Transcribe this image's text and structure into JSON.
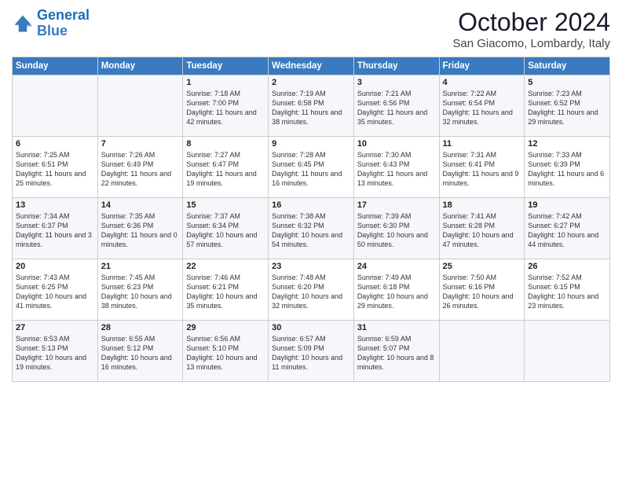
{
  "header": {
    "logo_line1": "General",
    "logo_line2": "Blue",
    "month": "October 2024",
    "location": "San Giacomo, Lombardy, Italy"
  },
  "days_of_week": [
    "Sunday",
    "Monday",
    "Tuesday",
    "Wednesday",
    "Thursday",
    "Friday",
    "Saturday"
  ],
  "weeks": [
    [
      {
        "day": "",
        "content": ""
      },
      {
        "day": "",
        "content": ""
      },
      {
        "day": "1",
        "content": "Sunrise: 7:18 AM\nSunset: 7:00 PM\nDaylight: 11 hours\nand 42 minutes."
      },
      {
        "day": "2",
        "content": "Sunrise: 7:19 AM\nSunset: 6:58 PM\nDaylight: 11 hours\nand 38 minutes."
      },
      {
        "day": "3",
        "content": "Sunrise: 7:21 AM\nSunset: 6:56 PM\nDaylight: 11 hours\nand 35 minutes."
      },
      {
        "day": "4",
        "content": "Sunrise: 7:22 AM\nSunset: 6:54 PM\nDaylight: 11 hours\nand 32 minutes."
      },
      {
        "day": "5",
        "content": "Sunrise: 7:23 AM\nSunset: 6:52 PM\nDaylight: 11 hours\nand 29 minutes."
      }
    ],
    [
      {
        "day": "6",
        "content": "Sunrise: 7:25 AM\nSunset: 6:51 PM\nDaylight: 11 hours\nand 25 minutes."
      },
      {
        "day": "7",
        "content": "Sunrise: 7:26 AM\nSunset: 6:49 PM\nDaylight: 11 hours\nand 22 minutes."
      },
      {
        "day": "8",
        "content": "Sunrise: 7:27 AM\nSunset: 6:47 PM\nDaylight: 11 hours\nand 19 minutes."
      },
      {
        "day": "9",
        "content": "Sunrise: 7:28 AM\nSunset: 6:45 PM\nDaylight: 11 hours\nand 16 minutes."
      },
      {
        "day": "10",
        "content": "Sunrise: 7:30 AM\nSunset: 6:43 PM\nDaylight: 11 hours\nand 13 minutes."
      },
      {
        "day": "11",
        "content": "Sunrise: 7:31 AM\nSunset: 6:41 PM\nDaylight: 11 hours\nand 9 minutes."
      },
      {
        "day": "12",
        "content": "Sunrise: 7:33 AM\nSunset: 6:39 PM\nDaylight: 11 hours\nand 6 minutes."
      }
    ],
    [
      {
        "day": "13",
        "content": "Sunrise: 7:34 AM\nSunset: 6:37 PM\nDaylight: 11 hours\nand 3 minutes."
      },
      {
        "day": "14",
        "content": "Sunrise: 7:35 AM\nSunset: 6:36 PM\nDaylight: 11 hours\nand 0 minutes."
      },
      {
        "day": "15",
        "content": "Sunrise: 7:37 AM\nSunset: 6:34 PM\nDaylight: 10 hours\nand 57 minutes."
      },
      {
        "day": "16",
        "content": "Sunrise: 7:38 AM\nSunset: 6:32 PM\nDaylight: 10 hours\nand 54 minutes."
      },
      {
        "day": "17",
        "content": "Sunrise: 7:39 AM\nSunset: 6:30 PM\nDaylight: 10 hours\nand 50 minutes."
      },
      {
        "day": "18",
        "content": "Sunrise: 7:41 AM\nSunset: 6:28 PM\nDaylight: 10 hours\nand 47 minutes."
      },
      {
        "day": "19",
        "content": "Sunrise: 7:42 AM\nSunset: 6:27 PM\nDaylight: 10 hours\nand 44 minutes."
      }
    ],
    [
      {
        "day": "20",
        "content": "Sunrise: 7:43 AM\nSunset: 6:25 PM\nDaylight: 10 hours\nand 41 minutes."
      },
      {
        "day": "21",
        "content": "Sunrise: 7:45 AM\nSunset: 6:23 PM\nDaylight: 10 hours\nand 38 minutes."
      },
      {
        "day": "22",
        "content": "Sunrise: 7:46 AM\nSunset: 6:21 PM\nDaylight: 10 hours\nand 35 minutes."
      },
      {
        "day": "23",
        "content": "Sunrise: 7:48 AM\nSunset: 6:20 PM\nDaylight: 10 hours\nand 32 minutes."
      },
      {
        "day": "24",
        "content": "Sunrise: 7:49 AM\nSunset: 6:18 PM\nDaylight: 10 hours\nand 29 minutes."
      },
      {
        "day": "25",
        "content": "Sunrise: 7:50 AM\nSunset: 6:16 PM\nDaylight: 10 hours\nand 26 minutes."
      },
      {
        "day": "26",
        "content": "Sunrise: 7:52 AM\nSunset: 6:15 PM\nDaylight: 10 hours\nand 23 minutes."
      }
    ],
    [
      {
        "day": "27",
        "content": "Sunrise: 6:53 AM\nSunset: 5:13 PM\nDaylight: 10 hours\nand 19 minutes."
      },
      {
        "day": "28",
        "content": "Sunrise: 6:55 AM\nSunset: 5:12 PM\nDaylight: 10 hours\nand 16 minutes."
      },
      {
        "day": "29",
        "content": "Sunrise: 6:56 AM\nSunset: 5:10 PM\nDaylight: 10 hours\nand 13 minutes."
      },
      {
        "day": "30",
        "content": "Sunrise: 6:57 AM\nSunset: 5:09 PM\nDaylight: 10 hours\nand 11 minutes."
      },
      {
        "day": "31",
        "content": "Sunrise: 6:59 AM\nSunset: 5:07 PM\nDaylight: 10 hours\nand 8 minutes."
      },
      {
        "day": "",
        "content": ""
      },
      {
        "day": "",
        "content": ""
      }
    ]
  ]
}
